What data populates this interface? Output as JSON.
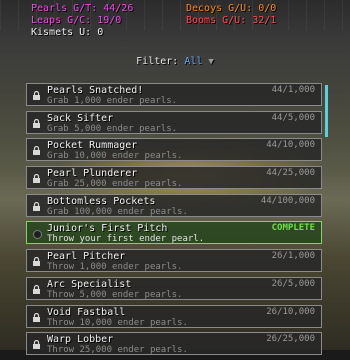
{
  "stats": {
    "pearls": "Pearls G/T: 44/26",
    "decoys": "Decoys G/U: 0/0",
    "leaps": "Leaps G/C: 19/0",
    "booms": "Booms G/U: 32/1",
    "kismets": "Kismets U: 0"
  },
  "filter": {
    "label": "Filter:",
    "value": "All",
    "caret": "▼"
  },
  "achievements": [
    {
      "title": "Pearls Snatched!",
      "desc": "Grab 1,000 ender pearls.",
      "progress": "44/1,000",
      "complete": false
    },
    {
      "title": "Sack Sifter",
      "desc": "Grab 5,000 ender pearls.",
      "progress": "44/5,000",
      "complete": false
    },
    {
      "title": "Pocket Rummager",
      "desc": "Grab 10,000 ender pearls.",
      "progress": "44/10,000",
      "complete": false
    },
    {
      "title": "Pearl Plunderer",
      "desc": "Grab 25,000 ender pearls.",
      "progress": "44/25,000",
      "complete": false
    },
    {
      "title": "Bottomless Pockets",
      "desc": "Grab 100,000 ender pearls.",
      "progress": "44/100,000",
      "complete": false
    },
    {
      "title": "Junior's First Pitch",
      "desc": "Throw your first ender pearl.",
      "progress": "COMPLETE",
      "complete": true
    },
    {
      "title": "Pearl Pitcher",
      "desc": "Throw 1,000 ender pearls.",
      "progress": "26/1,000",
      "complete": false
    },
    {
      "title": "Arc Specialist",
      "desc": "Throw 5,000 ender pearls.",
      "progress": "26/5,000",
      "complete": false
    },
    {
      "title": "Void Fastball",
      "desc": "Throw 10,000 ender pearls.",
      "progress": "26/10,000",
      "complete": false
    },
    {
      "title": "Warp Lobber",
      "desc": "Throw 25,000 ender pearls.",
      "progress": "26/25,000",
      "complete": false
    }
  ],
  "colors": {
    "complete": "#6fe04a",
    "filter_value": "#6aa8ff",
    "scrollbar": "#5ad0dc"
  }
}
